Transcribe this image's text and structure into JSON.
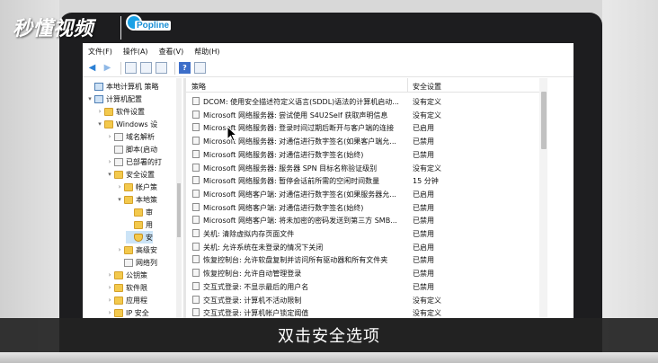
{
  "watermark": {
    "logo": "秒懂视频",
    "brand": "Popline"
  },
  "menu": [
    "文件(F)",
    "操作(A)",
    "查看(V)",
    "帮助(H)"
  ],
  "tree": [
    {
      "label": "本地计算机 策略",
      "icon": "computer-icon",
      "chevron": ""
    },
    {
      "label": "计算机配置",
      "icon": "computer-icon",
      "chevron": "▾"
    },
    {
      "label": "软件设置",
      "icon": "folder-icon",
      "chevron": "›"
    },
    {
      "label": "Windows 设",
      "icon": "folder-icon",
      "chevron": "▾"
    },
    {
      "label": "域名解析",
      "icon": "document-icon",
      "chevron": "›"
    },
    {
      "label": "脚本(启动",
      "icon": "document-icon",
      "chevron": ""
    },
    {
      "label": "已部署的打",
      "icon": "document-icon",
      "chevron": "›"
    },
    {
      "label": "安全设置",
      "icon": "folder-icon",
      "chevron": "▾"
    },
    {
      "label": "帐户策",
      "icon": "folder-icon",
      "chevron": "›"
    },
    {
      "label": "本地策",
      "icon": "folder-icon",
      "chevron": "▾"
    },
    {
      "label": "审",
      "icon": "folder-icon",
      "chevron": ""
    },
    {
      "label": "用",
      "icon": "folder-icon",
      "chevron": ""
    },
    {
      "label": "安",
      "icon": "shield-icon",
      "chevron": ""
    },
    {
      "label": "高级安",
      "icon": "folder-icon",
      "chevron": "›"
    },
    {
      "label": "网络列",
      "icon": "document-icon",
      "chevron": ""
    },
    {
      "label": "公钥策",
      "icon": "folder-icon",
      "chevron": "›"
    },
    {
      "label": "软件限",
      "icon": "folder-icon",
      "chevron": "›"
    },
    {
      "label": "应用程",
      "icon": "folder-icon",
      "chevron": "›"
    },
    {
      "label": "IP 安全",
      "icon": "folder-icon",
      "chevron": "›"
    }
  ],
  "list": {
    "headers": {
      "policy": "策略",
      "setting": "安全设置"
    },
    "rows": [
      {
        "policy": "DCOM: 使用安全描述符定义语言(SDDL)语法的计算机启动...",
        "setting": "没有定义"
      },
      {
        "policy": "Microsoft 网络服务器: 尝试使用 S4U2Self 获取声明信息",
        "setting": "没有定义"
      },
      {
        "policy": "Microsoft 网络服务器: 登录时间过期后断开与客户端的连接",
        "setting": "已启用"
      },
      {
        "policy": "Microsoft 网络服务器: 对通信进行数字签名(如果客户端允...",
        "setting": "已禁用"
      },
      {
        "policy": "Microsoft 网络服务器: 对通信进行数字签名(始终)",
        "setting": "已禁用"
      },
      {
        "policy": "Microsoft 网络服务器: 服务器 SPN 目标名称验证级别",
        "setting": "没有定义"
      },
      {
        "policy": "Microsoft 网络服务器: 暂停会话前所需的空闲时间数量",
        "setting": "15 分钟"
      },
      {
        "policy": "Microsoft 网络客户端: 对通信进行数字签名(如果服务器允...",
        "setting": "已启用"
      },
      {
        "policy": "Microsoft 网络客户端: 对通信进行数字签名(始终)",
        "setting": "已禁用"
      },
      {
        "policy": "Microsoft 网络客户端: 将未加密的密码发送到第三方 SMB...",
        "setting": "已禁用"
      },
      {
        "policy": "关机: 清除虚拟内存页面文件",
        "setting": "已禁用"
      },
      {
        "policy": "关机: 允许系统在未登录的情况下关闭",
        "setting": "已启用"
      },
      {
        "policy": "恢复控制台: 允许软盘复制并访问所有驱动器和所有文件夹",
        "setting": "已禁用"
      },
      {
        "policy": "恢复控制台: 允许自动管理登录",
        "setting": "已禁用"
      },
      {
        "policy": "交互式登录: 不显示最后的用户名",
        "setting": "已禁用"
      },
      {
        "policy": "交互式登录: 计算机不活动限制",
        "setting": "没有定义"
      },
      {
        "policy": "交互式登录: 计算机帐户锁定阈值",
        "setting": "没有定义"
      }
    ]
  },
  "caption": "双击安全选项",
  "colors": {
    "caption_bg": "#232323",
    "bezel": "#1d1d1f",
    "folder": "#f3c94d",
    "nav_arrow": "#2a7fd4"
  }
}
